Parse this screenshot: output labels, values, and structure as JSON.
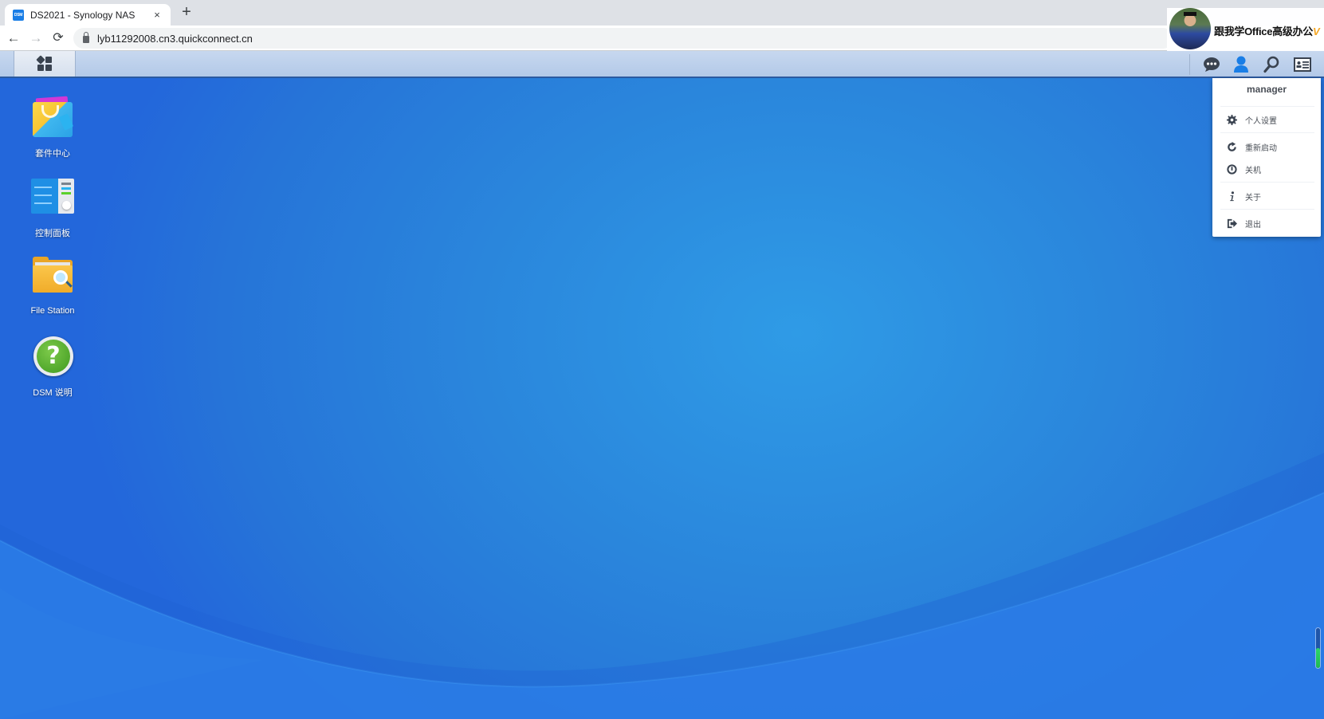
{
  "browser": {
    "tab": {
      "favicon_text": "DSM",
      "title": "DS2021 - Synology NAS",
      "close_glyph": "×"
    },
    "new_tab_glyph": "+",
    "nav": {
      "back_glyph": "←",
      "forward_glyph": "→",
      "reload_glyph": "⟳"
    },
    "url": "lyb11292008.cn3.quickconnect.cn"
  },
  "watermark": {
    "text": "跟我学Office高级办公",
    "suffix": "V"
  },
  "taskbar": {
    "main_menu_icon": "grid-icon",
    "right_icons": [
      "chat-icon",
      "user-icon",
      "search-icon",
      "widgets-icon"
    ]
  },
  "desktop": {
    "icons": [
      {
        "label": "套件中心",
        "icon": "package-center-icon"
      },
      {
        "label": "控制面板",
        "icon": "control-panel-icon"
      },
      {
        "label": "File Station",
        "icon": "file-station-icon"
      },
      {
        "label": "DSM 说明",
        "icon": "help-icon"
      }
    ],
    "help_glyph": "?",
    "widget_indicator_level": 0.5
  },
  "user_menu": {
    "username": "manager",
    "items": [
      {
        "label": "个人设置",
        "icon": "gear-icon"
      },
      {
        "label": "重新启动",
        "icon": "restart-icon"
      },
      {
        "label": "关机",
        "icon": "power-icon"
      },
      {
        "label": "关于",
        "icon": "info-icon"
      },
      {
        "label": "退出",
        "icon": "logout-icon"
      }
    ]
  },
  "colors": {
    "taskbar": "#bcd0eb",
    "desktop": "#2a7fd8",
    "menu_text": "#4a4f57",
    "icon_dark": "#3a4350",
    "user_accent": "#1a7ee6",
    "widget_green": "#2ed66a"
  }
}
